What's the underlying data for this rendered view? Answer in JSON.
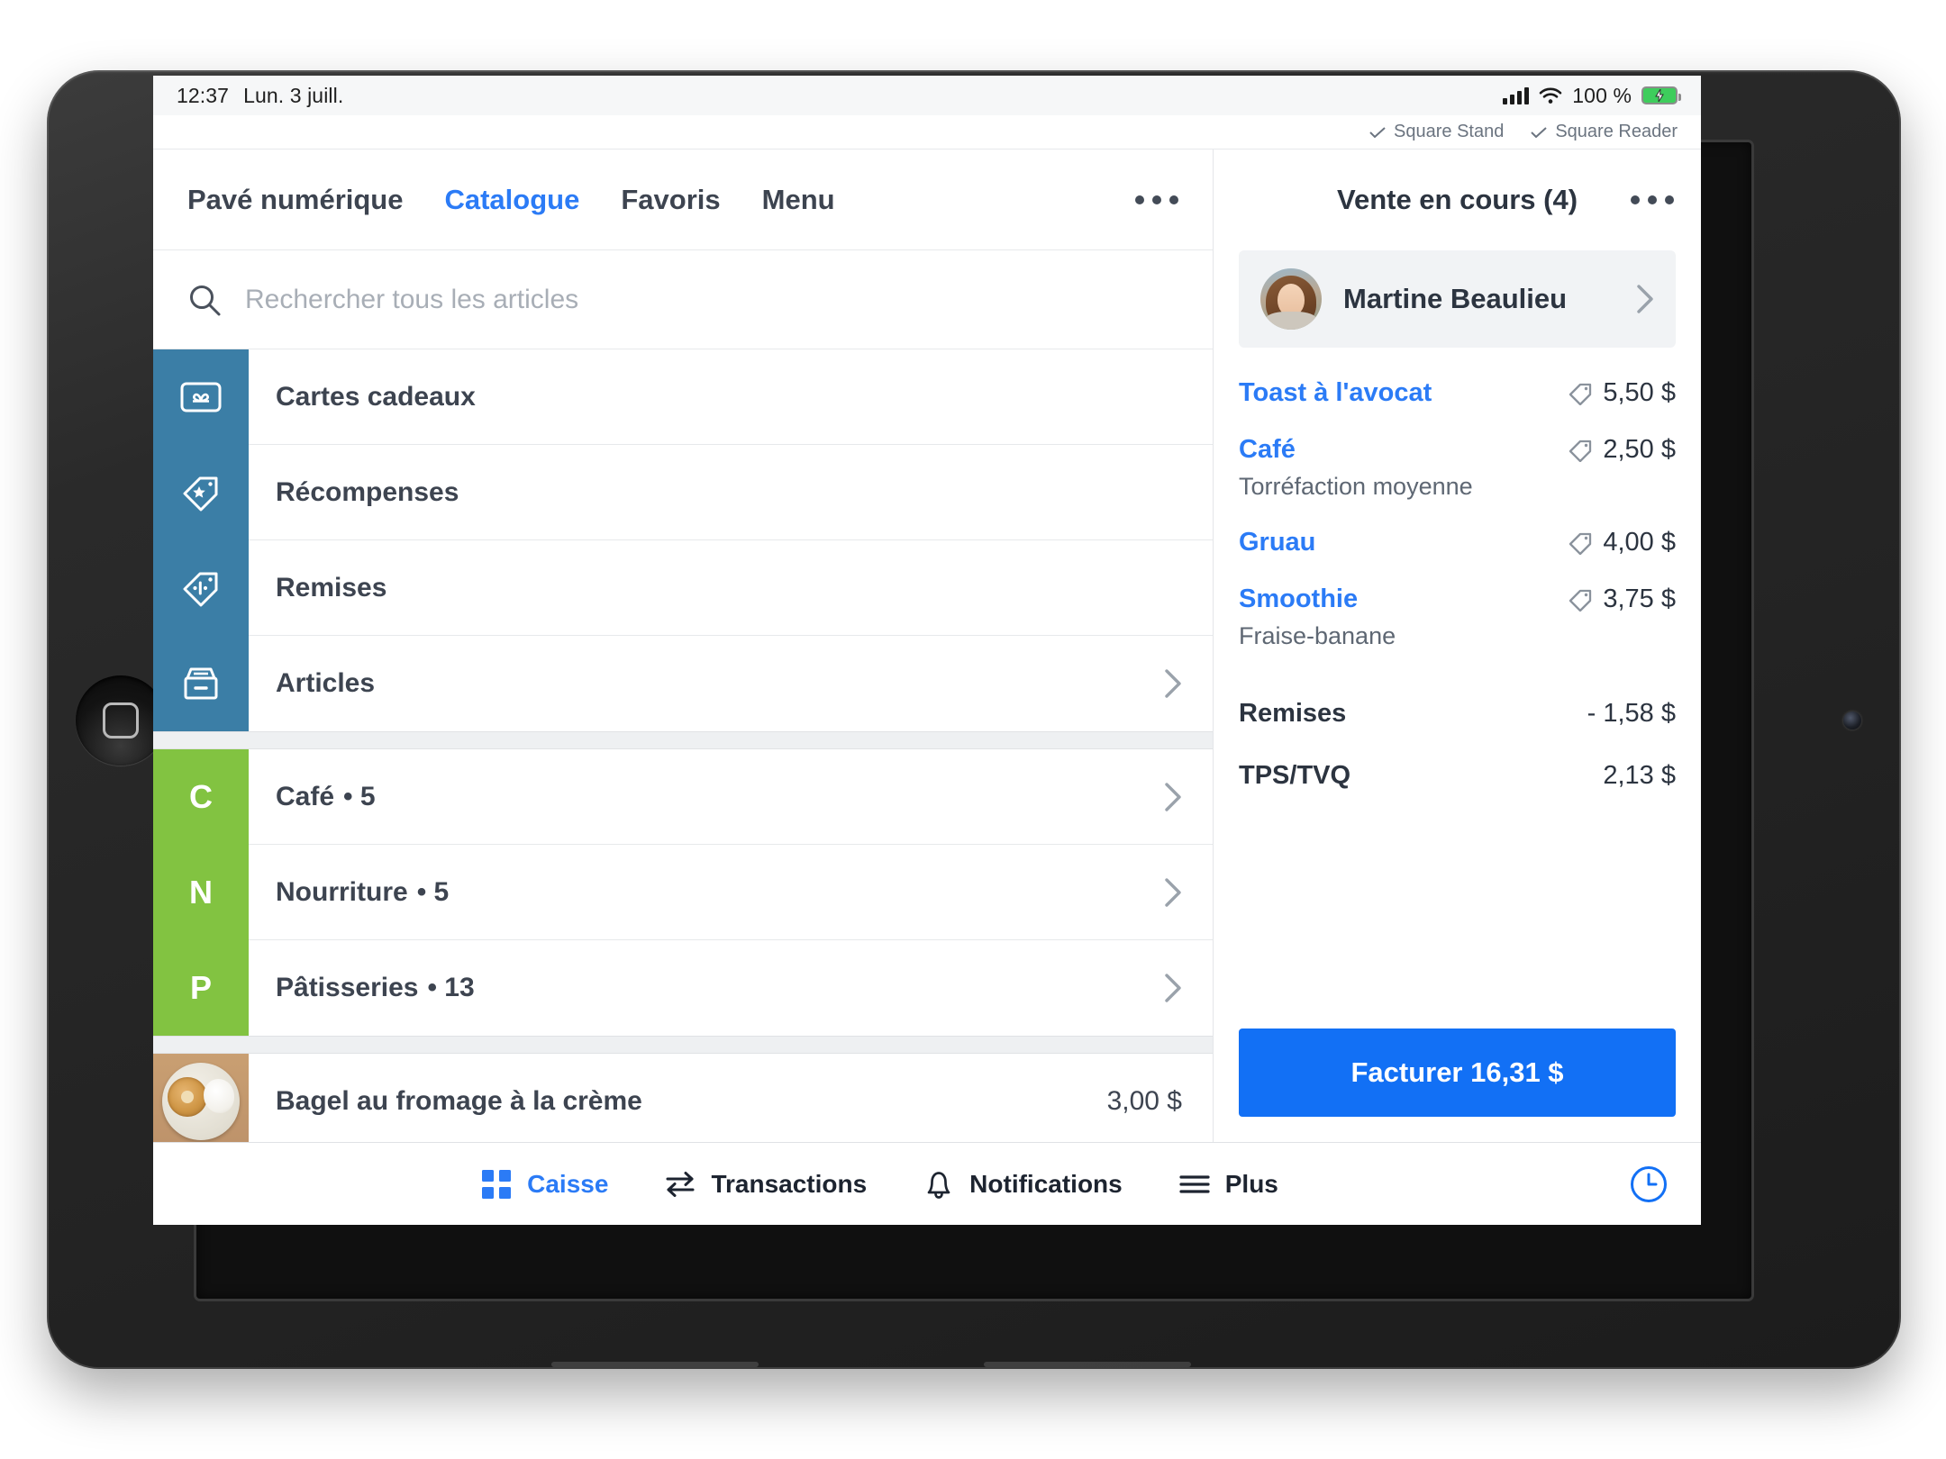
{
  "status_bar": {
    "time": "12:37",
    "date": "Lun. 3 juill.",
    "battery_percent": "100 %",
    "signal_icon": "cellular-signal-icon",
    "wifi_icon": "wifi-icon",
    "battery_icon": "battery-charging-icon"
  },
  "device_bar": {
    "items": [
      {
        "label": "Square Stand",
        "icon": "check-icon"
      },
      {
        "label": "Square Reader",
        "icon": "check-icon"
      }
    ]
  },
  "tabs": [
    {
      "label": "Pavé numérique",
      "active": false
    },
    {
      "label": "Catalogue",
      "active": true
    },
    {
      "label": "Favoris",
      "active": false
    },
    {
      "label": "Menu",
      "active": false
    }
  ],
  "overflow_icon": "ellipsis-icon",
  "search": {
    "placeholder": "Rechercher tous les articles",
    "value": "",
    "icon": "search-icon"
  },
  "catalog": {
    "group_blue_color": "#3b7ea6",
    "group_green_color": "#82c341",
    "blue_group": [
      {
        "label": "Cartes cadeaux",
        "icon": "gift-card-icon",
        "chevron": false
      },
      {
        "label": "Récompenses",
        "icon": "reward-tag-icon",
        "chevron": false
      },
      {
        "label": "Remises",
        "icon": "discount-tag-icon",
        "chevron": false
      },
      {
        "label": "Articles",
        "icon": "items-drawer-icon",
        "chevron": true
      }
    ],
    "green_group": [
      {
        "letter": "C",
        "label": "Café",
        "count": "• 5",
        "chevron": true
      },
      {
        "letter": "N",
        "label": "Nourriture",
        "count": "• 5",
        "chevron": true
      },
      {
        "letter": "P",
        "label": "Pâtisseries",
        "count": "• 13",
        "chevron": true
      }
    ],
    "product_rows": [
      {
        "label": "Bagel au fromage à la crème",
        "price": "3,00 $",
        "image": "bagel-cream-cheese-photo"
      }
    ]
  },
  "sale": {
    "title": "Vente en cours (4)",
    "overflow_icon": "ellipsis-icon",
    "customer": {
      "name": "Martine Beaulieu",
      "avatar": "customer-avatar-photo",
      "chevron_icon": "chevron-right-icon"
    },
    "items": [
      {
        "name": "Toast à l'avocat",
        "variant": "",
        "price": "5,50 $",
        "tag_icon": "price-tag-icon"
      },
      {
        "name": "Café",
        "variant": "Torréfaction moyenne",
        "price": "2,50 $",
        "tag_icon": "price-tag-icon"
      },
      {
        "name": "Gruau",
        "variant": "",
        "price": "4,00 $",
        "tag_icon": "price-tag-icon"
      },
      {
        "name": "Smoothie",
        "variant": "Fraise-banane",
        "price": "3,75 $",
        "tag_icon": "price-tag-icon"
      }
    ],
    "totals": [
      {
        "label": "Remises",
        "value": "- 1,58 $"
      },
      {
        "label": "TPS/TVQ",
        "value": "2,13 $"
      }
    ],
    "charge_button": "Facturer 16,31 $",
    "accent_color": "#1270f5"
  },
  "bottom_nav": {
    "items": [
      {
        "label": "Caisse",
        "icon": "grid-register-icon",
        "active": true
      },
      {
        "label": "Transactions",
        "icon": "transfer-arrows-icon",
        "active": false
      },
      {
        "label": "Notifications",
        "icon": "bell-icon",
        "active": false
      },
      {
        "label": "Plus",
        "icon": "hamburger-menu-icon",
        "active": false
      }
    ],
    "clock_icon": "clock-icon"
  }
}
